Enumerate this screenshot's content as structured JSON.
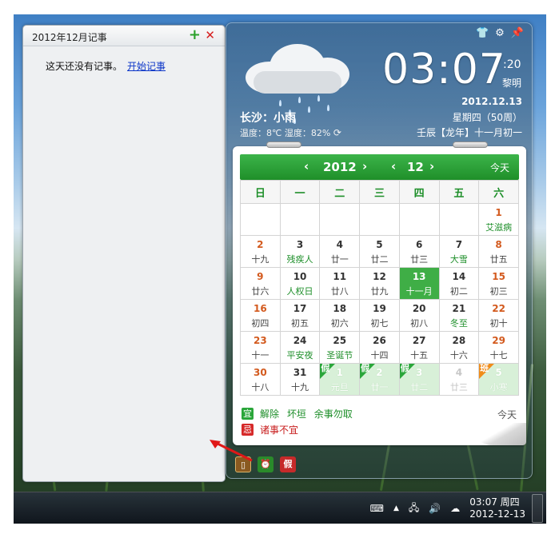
{
  "notes": {
    "title": "2012年12月记事",
    "empty_text": "这天还没有记事。",
    "start_link": "开始记事",
    "add_icon": "+",
    "close_icon": "✕"
  },
  "widget": {
    "time": "03:07",
    "seconds": ":20",
    "period": "黎明",
    "date": "2012.12.13",
    "weekday": "星期四（50周）",
    "lunar": "壬辰【龙年】十一月初一",
    "city": "长沙：小雨",
    "weather": "温度：8℃ 湿度：82%",
    "top_icons": [
      "shirt-icon",
      "gear-icon",
      "pin-icon"
    ]
  },
  "calendar": {
    "year": "2012",
    "month": "12",
    "today_button": "今天",
    "prev": "‹",
    "next": "›",
    "weekdays": [
      "日",
      "一",
      "二",
      "三",
      "四",
      "五",
      "六"
    ],
    "weeks": [
      [
        {
          "d": "",
          "l": ""
        },
        {
          "d": "",
          "l": ""
        },
        {
          "d": "",
          "l": ""
        },
        {
          "d": "",
          "l": ""
        },
        {
          "d": "",
          "l": ""
        },
        {
          "d": "",
          "l": ""
        },
        {
          "d": "1",
          "l": "艾滋病",
          "cls": "wkend fest"
        }
      ],
      [
        {
          "d": "2",
          "l": "十九",
          "cls": "wkend"
        },
        {
          "d": "3",
          "l": "残疾人",
          "cls": "fest"
        },
        {
          "d": "4",
          "l": "廿一"
        },
        {
          "d": "5",
          "l": "廿二"
        },
        {
          "d": "6",
          "l": "廿三"
        },
        {
          "d": "7",
          "l": "大雪",
          "cls": "fest"
        },
        {
          "d": "8",
          "l": "廿五",
          "cls": "wkend"
        }
      ],
      [
        {
          "d": "9",
          "l": "廿六",
          "cls": "wkend"
        },
        {
          "d": "10",
          "l": "人权日",
          "cls": "fest"
        },
        {
          "d": "11",
          "l": "廿八"
        },
        {
          "d": "12",
          "l": "廿九"
        },
        {
          "d": "13",
          "l": "十一月",
          "cls": "today"
        },
        {
          "d": "14",
          "l": "初二"
        },
        {
          "d": "15",
          "l": "初三",
          "cls": "wkend"
        }
      ],
      [
        {
          "d": "16",
          "l": "初四",
          "cls": "wkend"
        },
        {
          "d": "17",
          "l": "初五"
        },
        {
          "d": "18",
          "l": "初六"
        },
        {
          "d": "19",
          "l": "初七"
        },
        {
          "d": "20",
          "l": "初八"
        },
        {
          "d": "21",
          "l": "冬至",
          "cls": "fest"
        },
        {
          "d": "22",
          "l": "初十",
          "cls": "wkend"
        }
      ],
      [
        {
          "d": "23",
          "l": "十一",
          "cls": "wkend"
        },
        {
          "d": "24",
          "l": "平安夜",
          "cls": "fest"
        },
        {
          "d": "25",
          "l": "圣诞节",
          "cls": "fest"
        },
        {
          "d": "26",
          "l": "十四"
        },
        {
          "d": "27",
          "l": "十五"
        },
        {
          "d": "28",
          "l": "十六"
        },
        {
          "d": "29",
          "l": "十七",
          "cls": "wkend"
        }
      ],
      [
        {
          "d": "30",
          "l": "十八",
          "cls": "wkend"
        },
        {
          "d": "31",
          "l": "十九"
        },
        {
          "d": "1",
          "l": "元旦",
          "cls": "holi",
          "tag": "假"
        },
        {
          "d": "2",
          "l": "廿一",
          "cls": "holi",
          "tag": "假"
        },
        {
          "d": "3",
          "l": "廿二",
          "cls": "holi",
          "tag": "假"
        },
        {
          "d": "4",
          "l": "廿三",
          "cls": "other"
        },
        {
          "d": "5",
          "l": "小寒",
          "cls": "holi",
          "tag": "班",
          "tagcls": "work"
        }
      ]
    ],
    "yi_label": "宜",
    "yi_items": [
      "解除",
      "坏垣",
      "余事勿取"
    ],
    "ji_label": "忌",
    "ji_text": "诸事不宜",
    "footer_today": "今天"
  },
  "bottom_icons": [
    {
      "name": "notes-tool-icon",
      "glyph": "▯",
      "color": "#8a5a20"
    },
    {
      "name": "alarm-tool-icon",
      "glyph": "⏰",
      "color": "#2a8a2a"
    },
    {
      "name": "holiday-tool-icon",
      "glyph": "假",
      "color": "#c62a2a"
    }
  ],
  "taskbar": {
    "time": "03:07 周四",
    "date": "2012-12-13",
    "tray_icons": [
      "keyboard-icon",
      "show-hidden-icon",
      "network-icon",
      "volume-icon",
      "weather-icon"
    ]
  }
}
